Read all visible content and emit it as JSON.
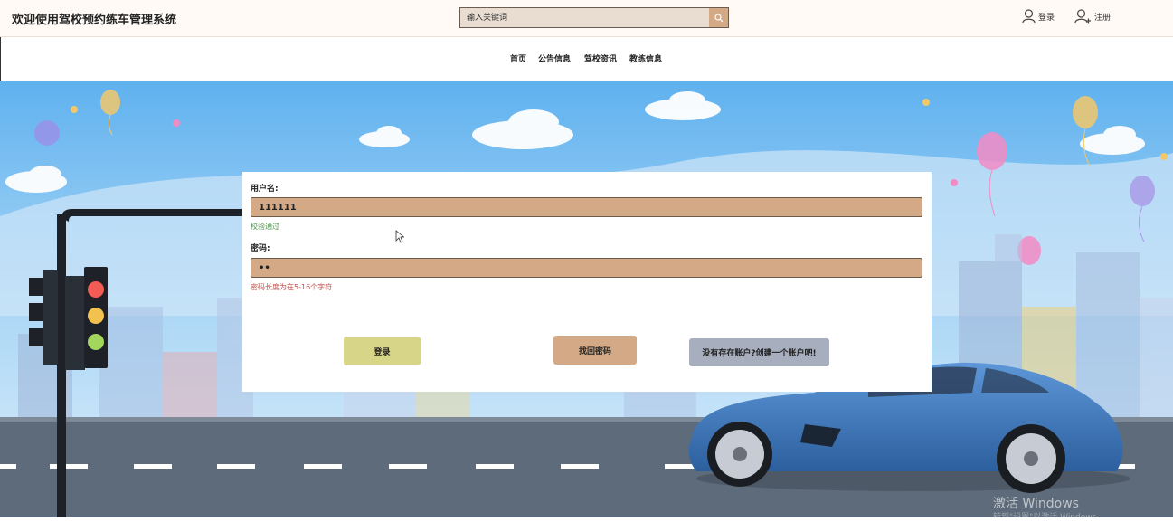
{
  "header": {
    "site_title": "欢迎使用驾校预约练车管理系统",
    "search_placeholder": "输入关键词",
    "login_label": "登录",
    "register_label": "注册"
  },
  "nav": {
    "items": [
      {
        "label": "首页"
      },
      {
        "label": "公告信息"
      },
      {
        "label": "驾校资讯"
      },
      {
        "label": "教练信息"
      }
    ]
  },
  "form": {
    "username_label": "用户名:",
    "username_value": "111111",
    "username_hint": "校验通过",
    "password_label": "密码:",
    "password_value": "••",
    "password_hint": "密码长度为在5-16个字符",
    "login_button": "登录",
    "forgot_button": "找回密码",
    "register_button": "没有存在账户?创建一个账户吧!"
  },
  "colors": {
    "accent": "#d4a985",
    "login_button": "#d6d588",
    "forgot_button": "#d4a985",
    "register_button": "#a7afbf",
    "valid_hint": "#4a8f4a",
    "error_hint": "#c0504d"
  },
  "watermark": "激活 Windows",
  "watermark_sub": "转到\"设置\"以激活 Windows。"
}
